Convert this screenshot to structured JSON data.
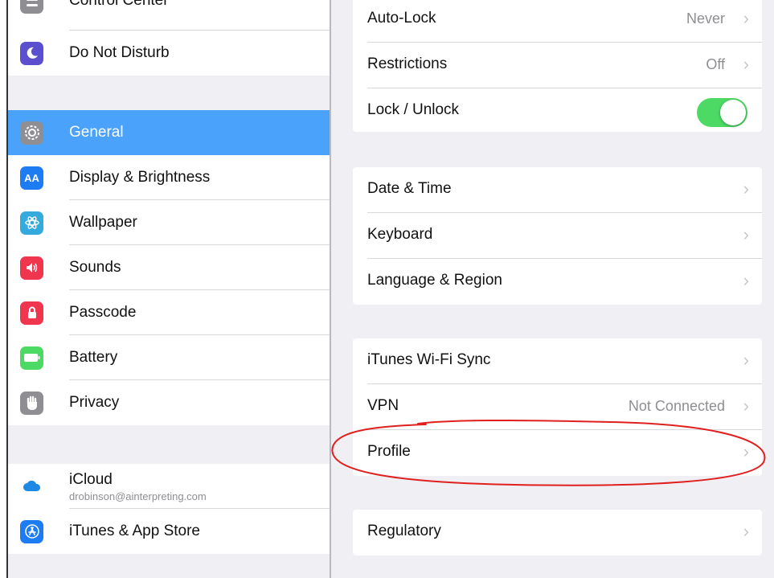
{
  "sidebar": {
    "top_partial": {
      "label": "Control Center",
      "icon": "control-center-icon"
    },
    "items": [
      {
        "label": "Do Not Disturb",
        "icon": "moon-icon",
        "color": "#5a4fcf"
      },
      {
        "label": "General",
        "icon": "gear-icon",
        "color": "#8e8e93",
        "selected": true
      },
      {
        "label": "Display & Brightness",
        "icon": "display-brightness-icon",
        "glyph": "AA",
        "color": "#1e7cf2"
      },
      {
        "label": "Wallpaper",
        "icon": "wallpaper-flower-icon",
        "color": "#35aadc"
      },
      {
        "label": "Sounds",
        "icon": "speaker-icon",
        "color": "#f0364f"
      },
      {
        "label": "Passcode",
        "icon": "lock-icon",
        "color": "#f0364f"
      },
      {
        "label": "Battery",
        "icon": "battery-icon",
        "color": "#4cd964"
      },
      {
        "label": "Privacy",
        "icon": "hand-icon",
        "color": "#8e8e93"
      },
      {
        "label": "iCloud",
        "sublabel": "drobinson@ainterpreting.com",
        "icon": "cloud-icon",
        "color": "#1e88e5"
      },
      {
        "label": "iTunes & App Store",
        "icon": "app-store-icon",
        "color": "#1e7cf2"
      }
    ]
  },
  "general": {
    "group1": [
      {
        "label": "Auto-Lock",
        "value": "Never"
      },
      {
        "label": "Restrictions",
        "value": "Off"
      },
      {
        "label": "Lock / Unlock",
        "toggle": true
      }
    ],
    "group2": [
      {
        "label": "Date & Time"
      },
      {
        "label": "Keyboard"
      },
      {
        "label": "Language & Region"
      }
    ],
    "group3": [
      {
        "label": "iTunes Wi-Fi Sync"
      },
      {
        "label": "VPN",
        "value": "Not Connected"
      },
      {
        "label": "Profile"
      }
    ],
    "group4": [
      {
        "label": "Regulatory"
      }
    ],
    "chevron": "›"
  },
  "colors": {
    "selected": "#4aa2fb",
    "toggle_on": "#4cd964",
    "annotation": "#e0201e"
  }
}
